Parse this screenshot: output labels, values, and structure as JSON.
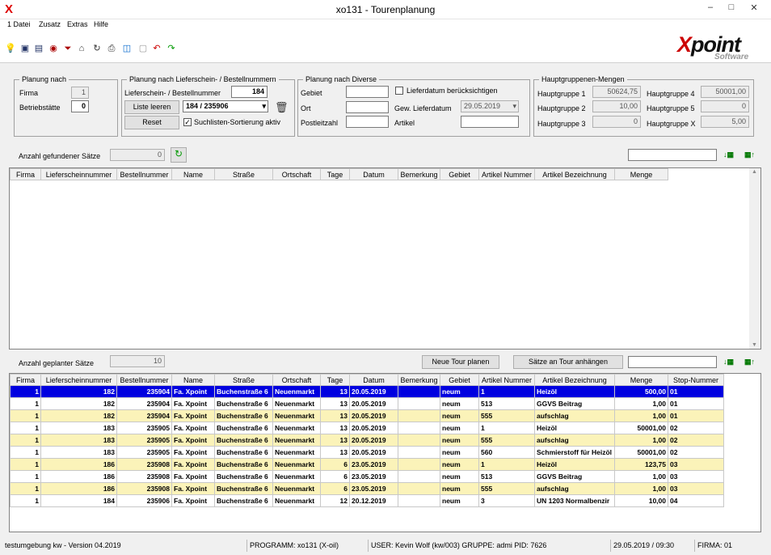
{
  "window": {
    "title": "xo131 - Tourenplanung",
    "minimize": "–",
    "maximize": "□",
    "close": "✕"
  },
  "menu": [
    "1 Datei",
    "Zusatz",
    "Extras",
    "Hilfe"
  ],
  "logo": {
    "brand_x": "X",
    "brand_rest": "point",
    "sub": "Software"
  },
  "planung_nach": {
    "legend": "Planung nach",
    "firma_label": "Firma",
    "firma_value": "1",
    "betriebsstaette_label": "Betriebstätte",
    "betriebsstaette_value": "0"
  },
  "planung_ls": {
    "legend": "Planung nach Lieferschein- / Bestellnummern",
    "nr_label": "Lieferschein- / Bestellnummer",
    "nr_value": "184",
    "liste_leeren": "Liste leeren",
    "combo_value": "184 / 235906",
    "reset": "Reset",
    "sort_label": "Suchlisten-Sortierung aktiv",
    "sort_checked": true
  },
  "planung_diverse": {
    "legend": "Planung nach Diverse",
    "gebiet_label": "Gebiet",
    "ort_label": "Ort",
    "plz_label": "Postleitzahl",
    "lieferdatum_chk_label": "Lieferdatum berücksichtigen",
    "gew_lieferdatum_label": "Gew. Lieferdatum",
    "gew_lieferdatum_value": "29.05.2019",
    "artikel_label": "Artikel"
  },
  "hauptgruppen": {
    "legend": "Hauptgruppenen-Mengen",
    "items": [
      {
        "label": "Hauptgruppe 1",
        "value": "50624,75"
      },
      {
        "label": "Hauptgruppe 2",
        "value": "10,00"
      },
      {
        "label": "Hauptgruppe 3",
        "value": "0"
      },
      {
        "label": "Hauptgruppe 4",
        "value": "50001,00"
      },
      {
        "label": "Hauptgruppe 5",
        "value": "0"
      },
      {
        "label": "Hauptgruppe X",
        "value": "5,00"
      }
    ]
  },
  "gefunden": {
    "label": "Anzahl gefundener Sätze",
    "value": "0"
  },
  "geplant": {
    "label": "Anzahl geplanter Sätze",
    "value": "10",
    "neue_tour": "Neue Tour planen",
    "saetze_anhaengen": "Sätze an Tour anhängen"
  },
  "columns_top": [
    "Firma",
    "Lieferscheinnummer",
    "Bestellnummer",
    "Name",
    "Straße",
    "Ortschaft",
    "Tage",
    "Datum",
    "Bemerkung",
    "Gebiet",
    "Artikel Nummer",
    "Artikel Bezeichnung",
    "Menge"
  ],
  "columns_bottom": [
    "Firma",
    "Lieferscheinnummer",
    "Bestellnummer",
    "Name",
    "Straße",
    "Ortschaft",
    "Tage",
    "Datum",
    "Bemerkung",
    "Gebiet",
    "Artikel Nummer",
    "Artikel Bezeichnung",
    "Menge",
    "Stop-Nummer"
  ],
  "rows": [
    [
      "1",
      "182",
      "235904",
      "Fa. Xpoint",
      "Buchenstraße 6",
      "Neuenmarkt",
      "13",
      "20.05.2019",
      "",
      "neum",
      "1",
      "Heizöl",
      "500,00",
      "01"
    ],
    [
      "1",
      "182",
      "235904",
      "Fa. Xpoint",
      "Buchenstraße 6",
      "Neuenmarkt",
      "13",
      "20.05.2019",
      "",
      "neum",
      "513",
      "GGVS Beitrag",
      "1,00",
      "01"
    ],
    [
      "1",
      "182",
      "235904",
      "Fa. Xpoint",
      "Buchenstraße 6",
      "Neuenmarkt",
      "13",
      "20.05.2019",
      "",
      "neum",
      "555",
      "aufschlag",
      "1,00",
      "01"
    ],
    [
      "1",
      "183",
      "235905",
      "Fa. Xpoint",
      "Buchenstraße 6",
      "Neuenmarkt",
      "13",
      "20.05.2019",
      "",
      "neum",
      "1",
      "Heizöl",
      "50001,00",
      "02"
    ],
    [
      "1",
      "183",
      "235905",
      "Fa. Xpoint",
      "Buchenstraße 6",
      "Neuenmarkt",
      "13",
      "20.05.2019",
      "",
      "neum",
      "555",
      "aufschlag",
      "1,00",
      "02"
    ],
    [
      "1",
      "183",
      "235905",
      "Fa. Xpoint",
      "Buchenstraße 6",
      "Neuenmarkt",
      "13",
      "20.05.2019",
      "",
      "neum",
      "560",
      "Schmierstoff für Heizöl",
      "50001,00",
      "02"
    ],
    [
      "1",
      "186",
      "235908",
      "Fa. Xpoint",
      "Buchenstraße 6",
      "Neuenmarkt",
      "6",
      "23.05.2019",
      "",
      "neum",
      "1",
      "Heizöl",
      "123,75",
      "03"
    ],
    [
      "1",
      "186",
      "235908",
      "Fa. Xpoint",
      "Buchenstraße 6",
      "Neuenmarkt",
      "6",
      "23.05.2019",
      "",
      "neum",
      "513",
      "GGVS Beitrag",
      "1,00",
      "03"
    ],
    [
      "1",
      "186",
      "235908",
      "Fa. Xpoint",
      "Buchenstraße 6",
      "Neuenmarkt",
      "6",
      "23.05.2019",
      "",
      "neum",
      "555",
      "aufschlag",
      "1,00",
      "03"
    ],
    [
      "1",
      "184",
      "235906",
      "Fa. Xpoint",
      "Buchenstraße 6",
      "Neuenmarkt",
      "12",
      "20.12.2019",
      "",
      "neum",
      "3",
      "UN 1203 Normalbenzir",
      "10,00",
      "04"
    ]
  ],
  "status": {
    "env": "testumgebung kw - Version 04.2019",
    "programm": "PROGRAMM: xo131 (X-oil)",
    "user": "USER: Kevin Wolf (kw/003)  GRUPPE: admi  PID: 7626",
    "datetime": "29.05.2019 / 09:30",
    "firma": "FIRMA: 01"
  }
}
